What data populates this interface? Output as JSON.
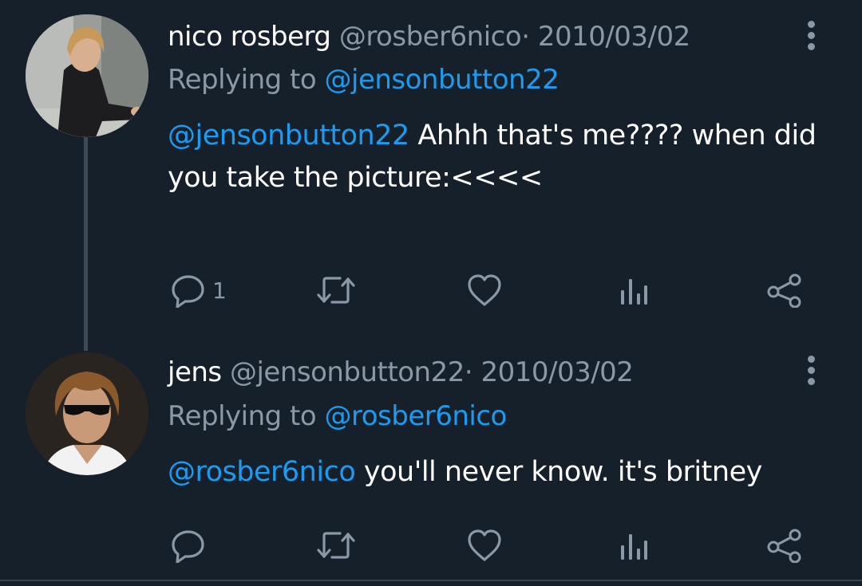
{
  "theme": {
    "background": "#15202b",
    "text": "#ffffff",
    "secondary": "#8b98a5",
    "accent": "#1d9bf0"
  },
  "tweets": [
    {
      "display_name": "nico rosberg",
      "handle": "@rosber6nico",
      "separator": "·",
      "date": "2010/03/02",
      "replying_label": "Replying to",
      "replying_to": "@jensonbutton22",
      "body_mention": "@jensonbutton22",
      "body_text": "Ahhh that's me???? when did you take the picture:<<<<",
      "reply_count": "1",
      "icons": [
        "more-vertical-icon",
        "reply-icon",
        "retweet-icon",
        "like-icon",
        "views-icon",
        "share-icon"
      ]
    },
    {
      "display_name": "jens",
      "handle": "@jensonbutton22",
      "separator": "·",
      "date": "2010/03/02",
      "replying_label": "Replying to",
      "replying_to": "@rosber6nico",
      "body_mention": "@rosber6nico",
      "body_text": "you'll never know. it's britney",
      "reply_count": "",
      "icons": [
        "more-vertical-icon",
        "reply-icon",
        "retweet-icon",
        "like-icon",
        "views-icon",
        "share-icon"
      ]
    }
  ]
}
